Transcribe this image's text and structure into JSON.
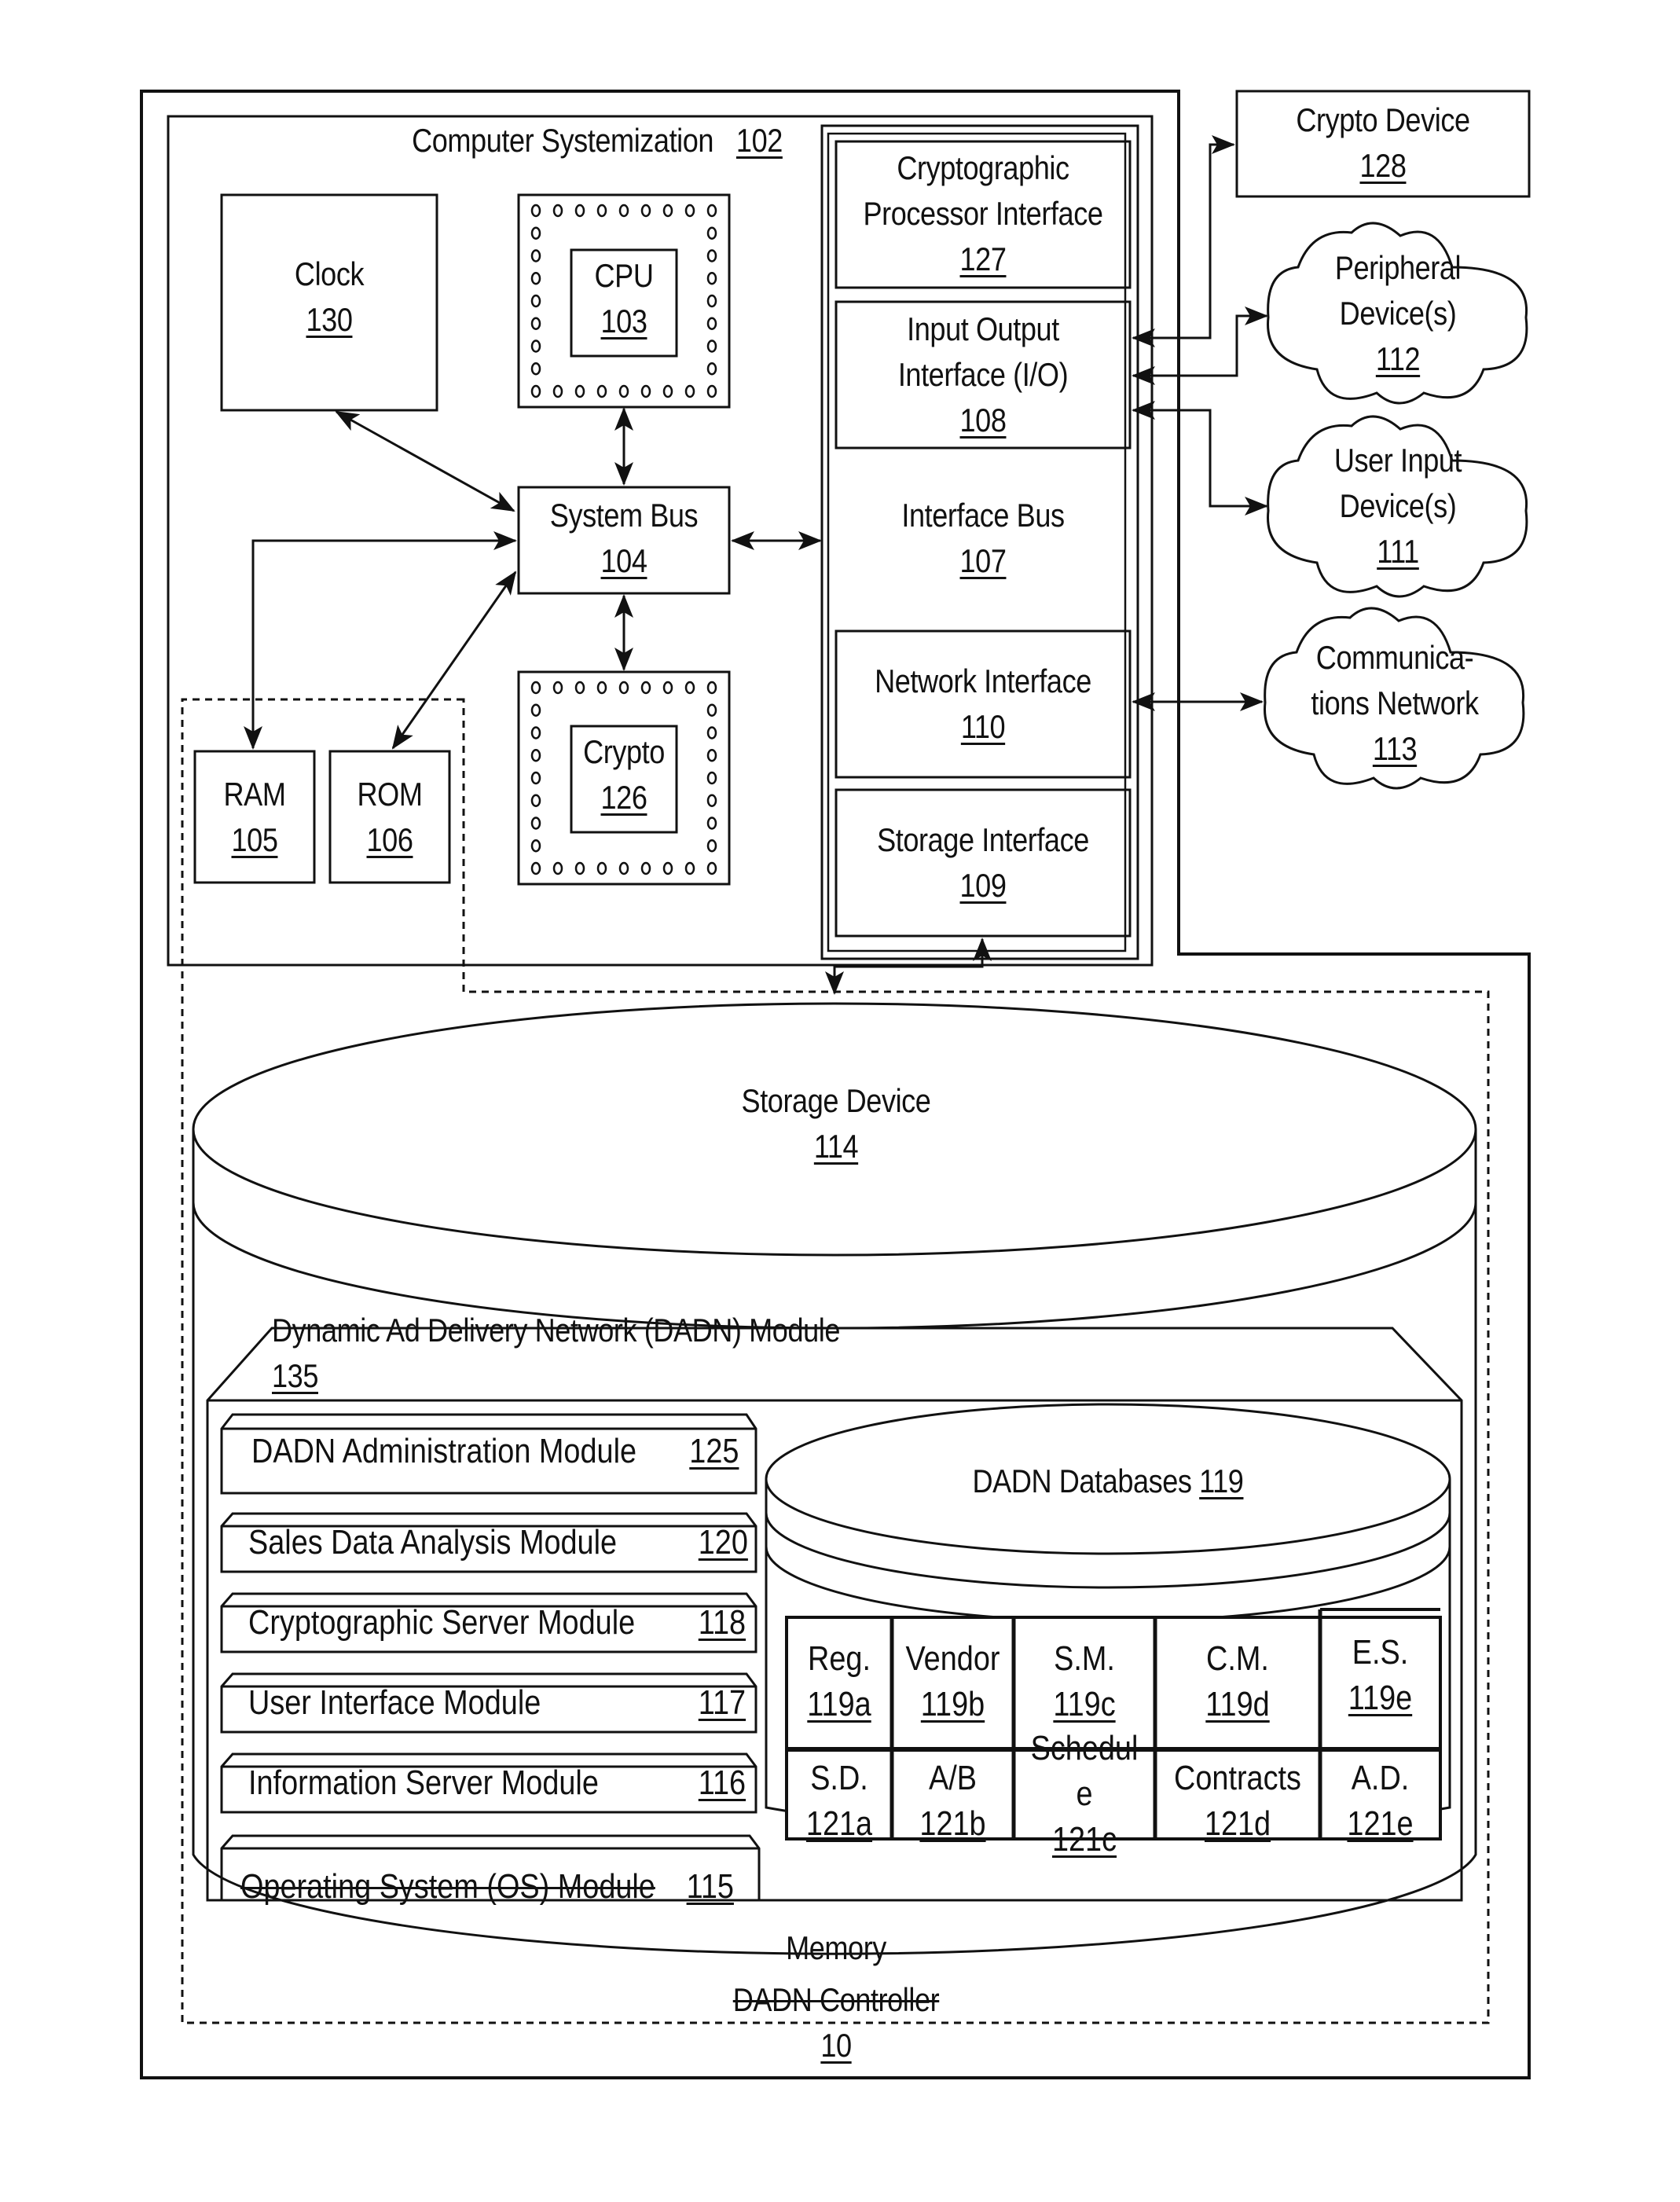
{
  "figure": {
    "controller": {
      "label": "DADN Controller",
      "ref": "10"
    },
    "memory": {
      "label": "Memory"
    },
    "computer_systemization": {
      "label": "Computer Systemization",
      "ref": "102"
    },
    "clock": {
      "label": "Clock",
      "ref": "130"
    },
    "cpu": {
      "label": "CPU",
      "ref": "103"
    },
    "system_bus": {
      "label": "System Bus",
      "ref": "104"
    },
    "crypto_chip": {
      "label": "Crypto",
      "ref": "126"
    },
    "ram": {
      "label": "RAM",
      "ref": "105"
    },
    "rom": {
      "label": "ROM",
      "ref": "106"
    },
    "interface_bus": {
      "label": "Interface Bus",
      "ref": "107"
    },
    "interfaces": [
      {
        "lines": [
          "Cryptographic",
          "Processor Interface"
        ],
        "ref": "127"
      },
      {
        "lines": [
          "Input Output",
          "Interface (I/O)"
        ],
        "ref": "108"
      },
      {
        "lines": [
          "Network Interface"
        ],
        "ref": "110"
      },
      {
        "lines": [
          "Storage Interface"
        ],
        "ref": "109"
      }
    ],
    "crypto_device": {
      "label": "Crypto Device",
      "ref": "128"
    },
    "clouds": [
      {
        "lines": [
          "Peripheral",
          "Device(s)"
        ],
        "ref": "112"
      },
      {
        "lines": [
          "User Input",
          "Device(s)"
        ],
        "ref": "111"
      },
      {
        "lines": [
          "Communica-",
          "tions Network"
        ],
        "ref": "113"
      }
    ],
    "storage_device": {
      "label": "Storage Device",
      "ref": "114"
    },
    "dadn_module": {
      "label": "Dynamic Ad Delivery Network (DADN) Module",
      "ref": "135"
    },
    "modules": [
      {
        "label": "DADN Administration Module",
        "ref": "125"
      },
      {
        "label": "Sales Data Analysis Module",
        "ref": "120"
      },
      {
        "label": "Cryptographic Server Module",
        "ref": "118"
      },
      {
        "label": "User Interface Module",
        "ref": "117"
      },
      {
        "label": "Information Server Module",
        "ref": "116"
      },
      {
        "label": "Operating System (OS) Module",
        "ref": "115"
      }
    ],
    "databases": {
      "label": "DADN Databases",
      "ref": "119",
      "rows": [
        [
          {
            "label": "Reg.",
            "ref": "119a"
          },
          {
            "label": "Vendor",
            "ref": "119b"
          },
          {
            "label": "S.M.",
            "ref": "119c"
          },
          {
            "label": "C.M.",
            "ref": "119d"
          },
          {
            "label": "E.S.",
            "ref": "119e"
          }
        ],
        [
          {
            "label": "S.D.",
            "ref": "121a"
          },
          {
            "label": "A/B",
            "ref": "121b"
          },
          {
            "label": "Schedul",
            "label2": "e",
            "ref": "121c"
          },
          {
            "label": "Contracts",
            "ref": "121d"
          },
          {
            "label": "A.D.",
            "ref": "121e"
          }
        ]
      ]
    }
  }
}
